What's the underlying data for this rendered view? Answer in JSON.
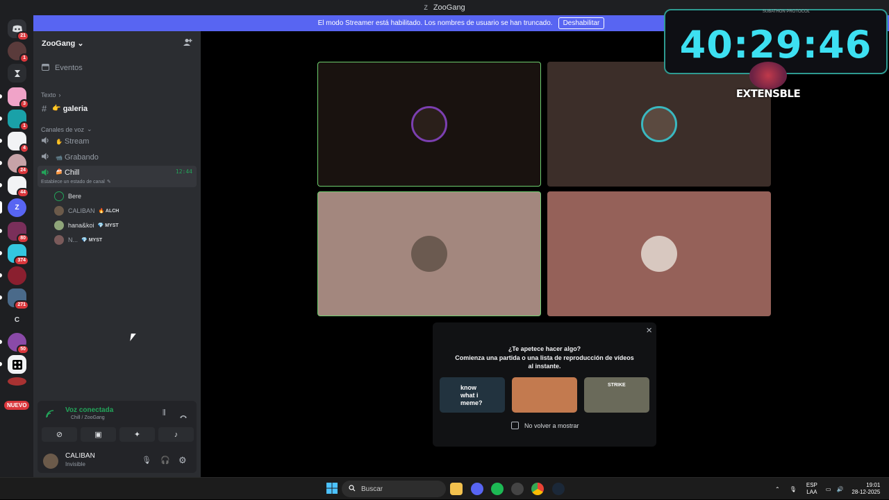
{
  "window": {
    "title": "ZooGang",
    "logo": "Z"
  },
  "banner": {
    "text": "El modo Streamer está habilitado. Los nombres de usuario se han truncado.",
    "button": "Deshabilitar"
  },
  "servers": [
    {
      "badge": "21"
    },
    {
      "badge": "1"
    },
    {
      "badge": ""
    },
    {
      "badge": "3"
    },
    {
      "badge": "1"
    },
    {
      "badge": "4"
    },
    {
      "badge": "24"
    },
    {
      "badge": "44"
    },
    {
      "badge": "",
      "label": "Z"
    },
    {
      "badge": "80"
    },
    {
      "badge": "374"
    },
    {
      "badge": ""
    },
    {
      "badge": "271"
    },
    {
      "badge": "",
      "label": "C"
    },
    {
      "badge": "50"
    },
    {
      "badge": ""
    }
  ],
  "nuevo": "NUEVO",
  "sidebar": {
    "guild": "ZooGang",
    "events": "Eventos",
    "text_category": "Texto",
    "text_channel": "galeria",
    "voice_category": "Canales de voz",
    "voice_channels": [
      "Stream",
      "Grabando",
      "Chill"
    ],
    "chill_time": "12:44",
    "chill_status": "Establece un estado de canal",
    "members": [
      {
        "name": "Bere",
        "tag": ""
      },
      {
        "name": "CALIBAN",
        "tag": "ALCH"
      },
      {
        "name": "hana&koi",
        "tag": "MYST"
      },
      {
        "name": "N...",
        "tag": "MYST"
      }
    ]
  },
  "voice_panel": {
    "status": "Voz conectada",
    "location": "Chill / ZooGang",
    "user": "CALIBAN",
    "user_status": "Invisible"
  },
  "popup": {
    "title": "¿Te apetece hacer algo?",
    "subtitle": "Comienza una partida o una lista de reproducción de vídeos al instante.",
    "card1_text": "know what i meme?",
    "card3_text": "STRIKE",
    "checkbox_label": "No volver a mostrar"
  },
  "overlay": {
    "timer": "40:29:46",
    "subtitle": "SUBATHON PROTOCOL",
    "brand": "EXTENSBLE"
  },
  "taskbar": {
    "search": "Buscar",
    "lang_top": "ESP",
    "lang_bottom": "LAA",
    "time": "19:01",
    "date": "28-12-2025"
  },
  "colors": {
    "accent": "#5865f2",
    "speaking": "#23a55a",
    "timer": "#3de0f2"
  }
}
